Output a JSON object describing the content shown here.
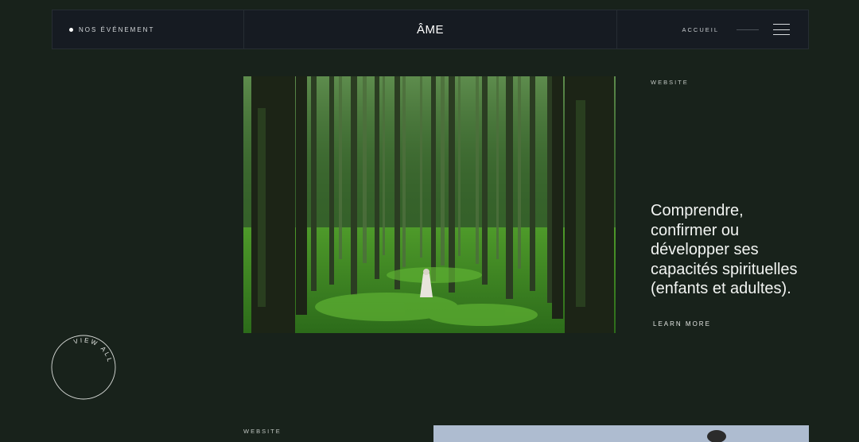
{
  "header": {
    "nav_left": "NOS ÉVÉNEMENT",
    "logo": "ÂME",
    "nav_right": "ACCUEIL"
  },
  "feature": {
    "tag": "WEBSITE",
    "headline": "Comprendre, confirmer ou développer ses capacités spirituelles (enfants et adultes).",
    "cta": "LEARN MORE"
  },
  "view_all": "VIEW ALL",
  "second": {
    "tag": "WEBSITE"
  },
  "icons": [
    "menu-icon",
    "dot-icon"
  ]
}
